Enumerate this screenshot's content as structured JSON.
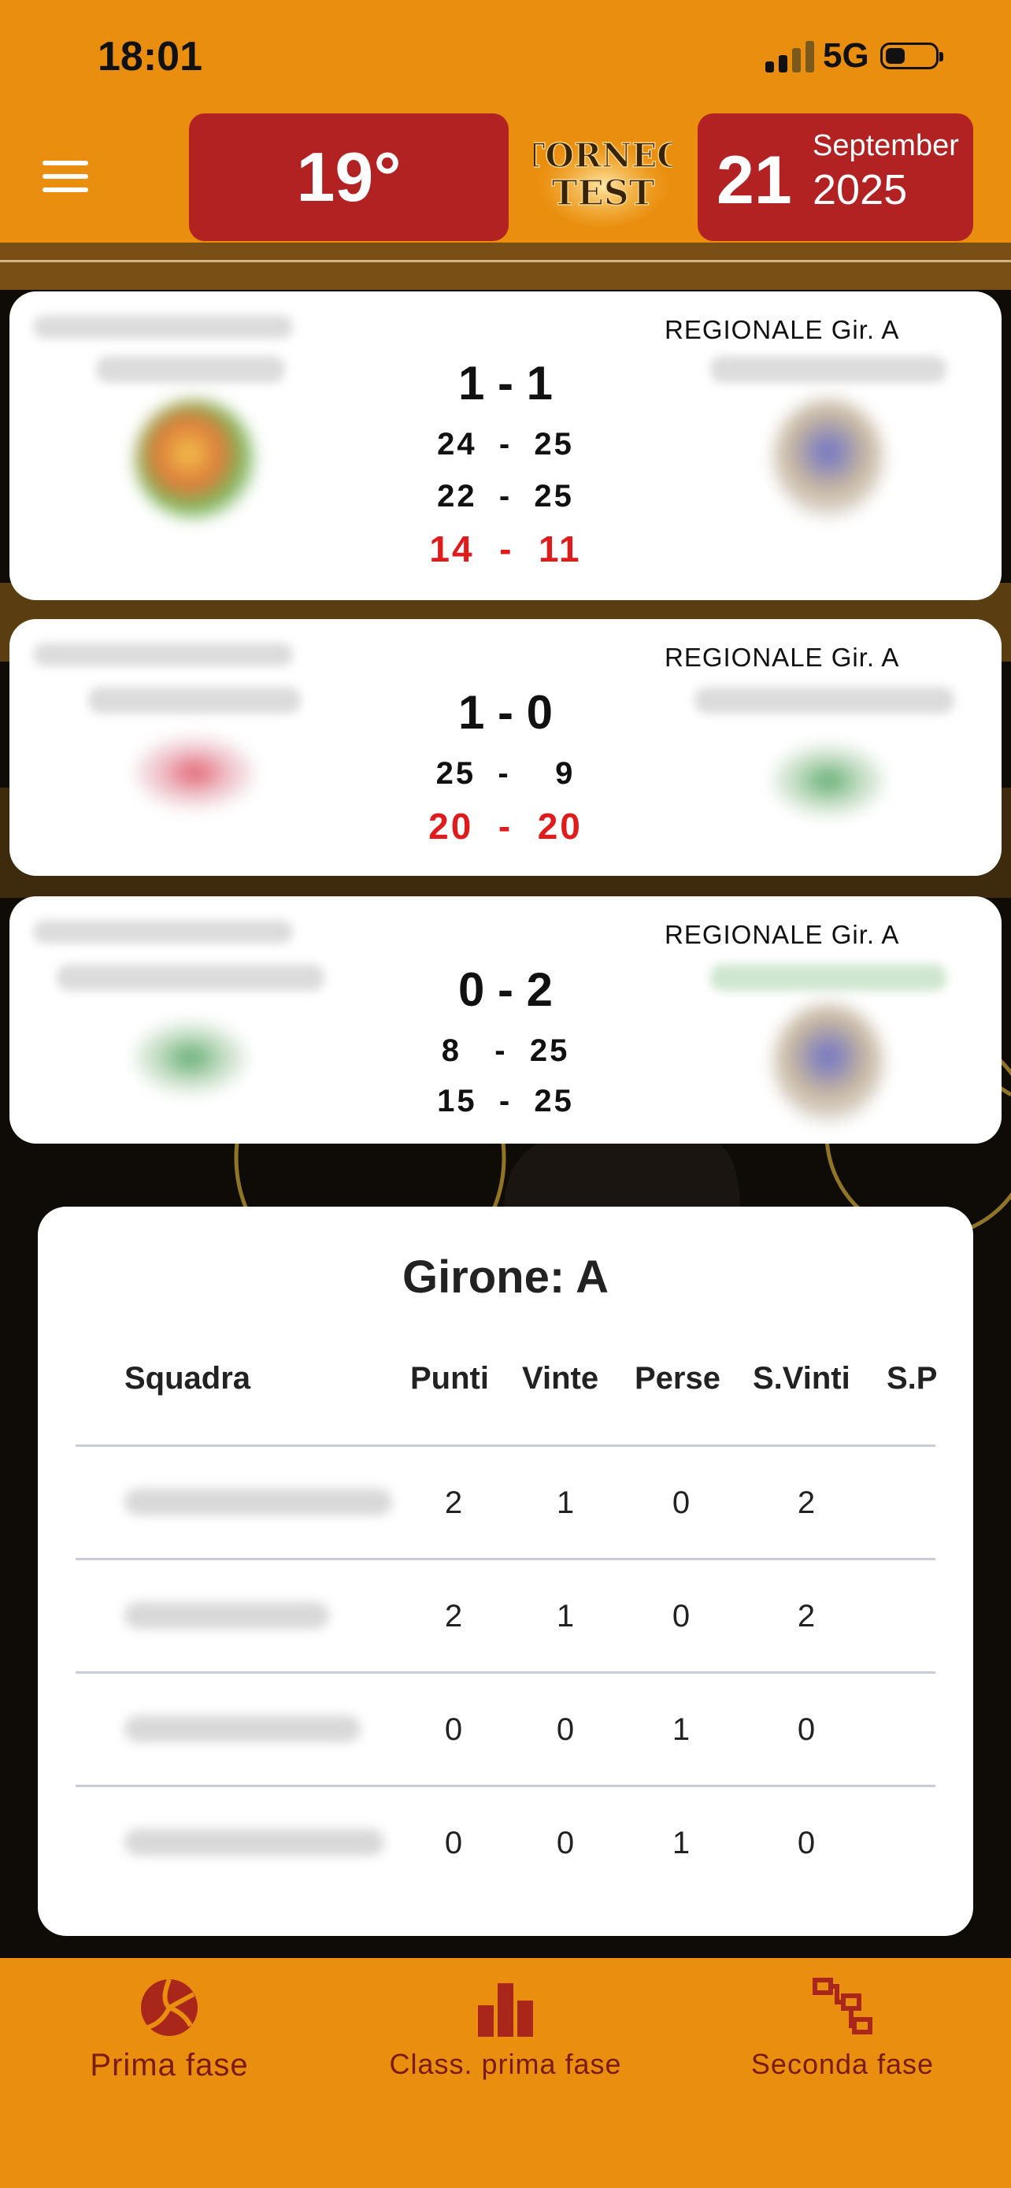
{
  "status_bar": {
    "time": "18:01",
    "network": "5G"
  },
  "header": {
    "temperature": "19°",
    "logo_text": {
      "line1": "TORNEO",
      "line2": "TEST"
    },
    "date": {
      "day": "21",
      "month": "September",
      "year": "2025"
    }
  },
  "matches": [
    {
      "league": "REGIONALE Gir. A",
      "score": "1 - 1",
      "sets": [
        "24  -  25",
        "22  -  25"
      ],
      "live_set": "14  -  11"
    },
    {
      "league": "REGIONALE Gir. A",
      "score": "1 - 0",
      "sets": [
        "25  -    9"
      ],
      "live_set": "20  -  20"
    },
    {
      "league": "REGIONALE Gir. A",
      "score": "0 - 2",
      "sets": [
        "8   -  25",
        "15  -  25"
      ]
    }
  ],
  "standings": {
    "title": "Girone: A",
    "columns": [
      "Squadra",
      "Punti",
      "Vinte",
      "Perse",
      "S.Vinti",
      "S.P"
    ],
    "rows": [
      {
        "punti": "2",
        "vinte": "1",
        "perse": "0",
        "svinti": "2"
      },
      {
        "punti": "2",
        "vinte": "1",
        "perse": "0",
        "svinti": "2"
      },
      {
        "punti": "0",
        "vinte": "0",
        "perse": "1",
        "svinti": "0"
      },
      {
        "punti": "0",
        "vinte": "0",
        "perse": "1",
        "svinti": "0"
      }
    ]
  },
  "bottom_nav": {
    "items": [
      {
        "label": "Prima fase",
        "icon": "volleyball-icon"
      },
      {
        "label": "Class. prima fase",
        "icon": "bar-chart-icon"
      },
      {
        "label": "Seconda fase",
        "icon": "bracket-icon"
      }
    ]
  },
  "colors": {
    "header": "#e98e0f",
    "accent_red": "#b22222",
    "live_score": "#e01b1b",
    "nav_text": "#7a1a10"
  }
}
